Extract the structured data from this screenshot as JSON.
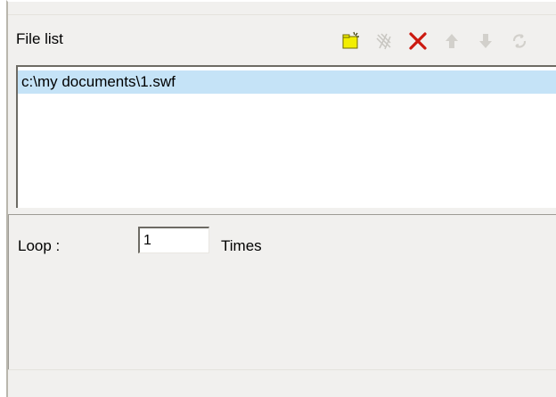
{
  "file_list": {
    "label": "File list",
    "items": [
      "c:\\my documents\\1.swf"
    ],
    "selected_index": 0
  },
  "toolbar": {
    "buttons": [
      {
        "icon": "add-file-icon",
        "enabled": true,
        "color": "#e6e600"
      },
      {
        "icon": "edit-file-icon",
        "enabled": false
      },
      {
        "icon": "delete-icon",
        "enabled": true,
        "color": "#cc0000"
      },
      {
        "icon": "move-up-icon",
        "enabled": false
      },
      {
        "icon": "move-down-icon",
        "enabled": false
      },
      {
        "icon": "refresh-icon",
        "enabled": false
      }
    ]
  },
  "loop": {
    "label": "Loop :",
    "value": "1",
    "unit_label": "Times"
  }
}
